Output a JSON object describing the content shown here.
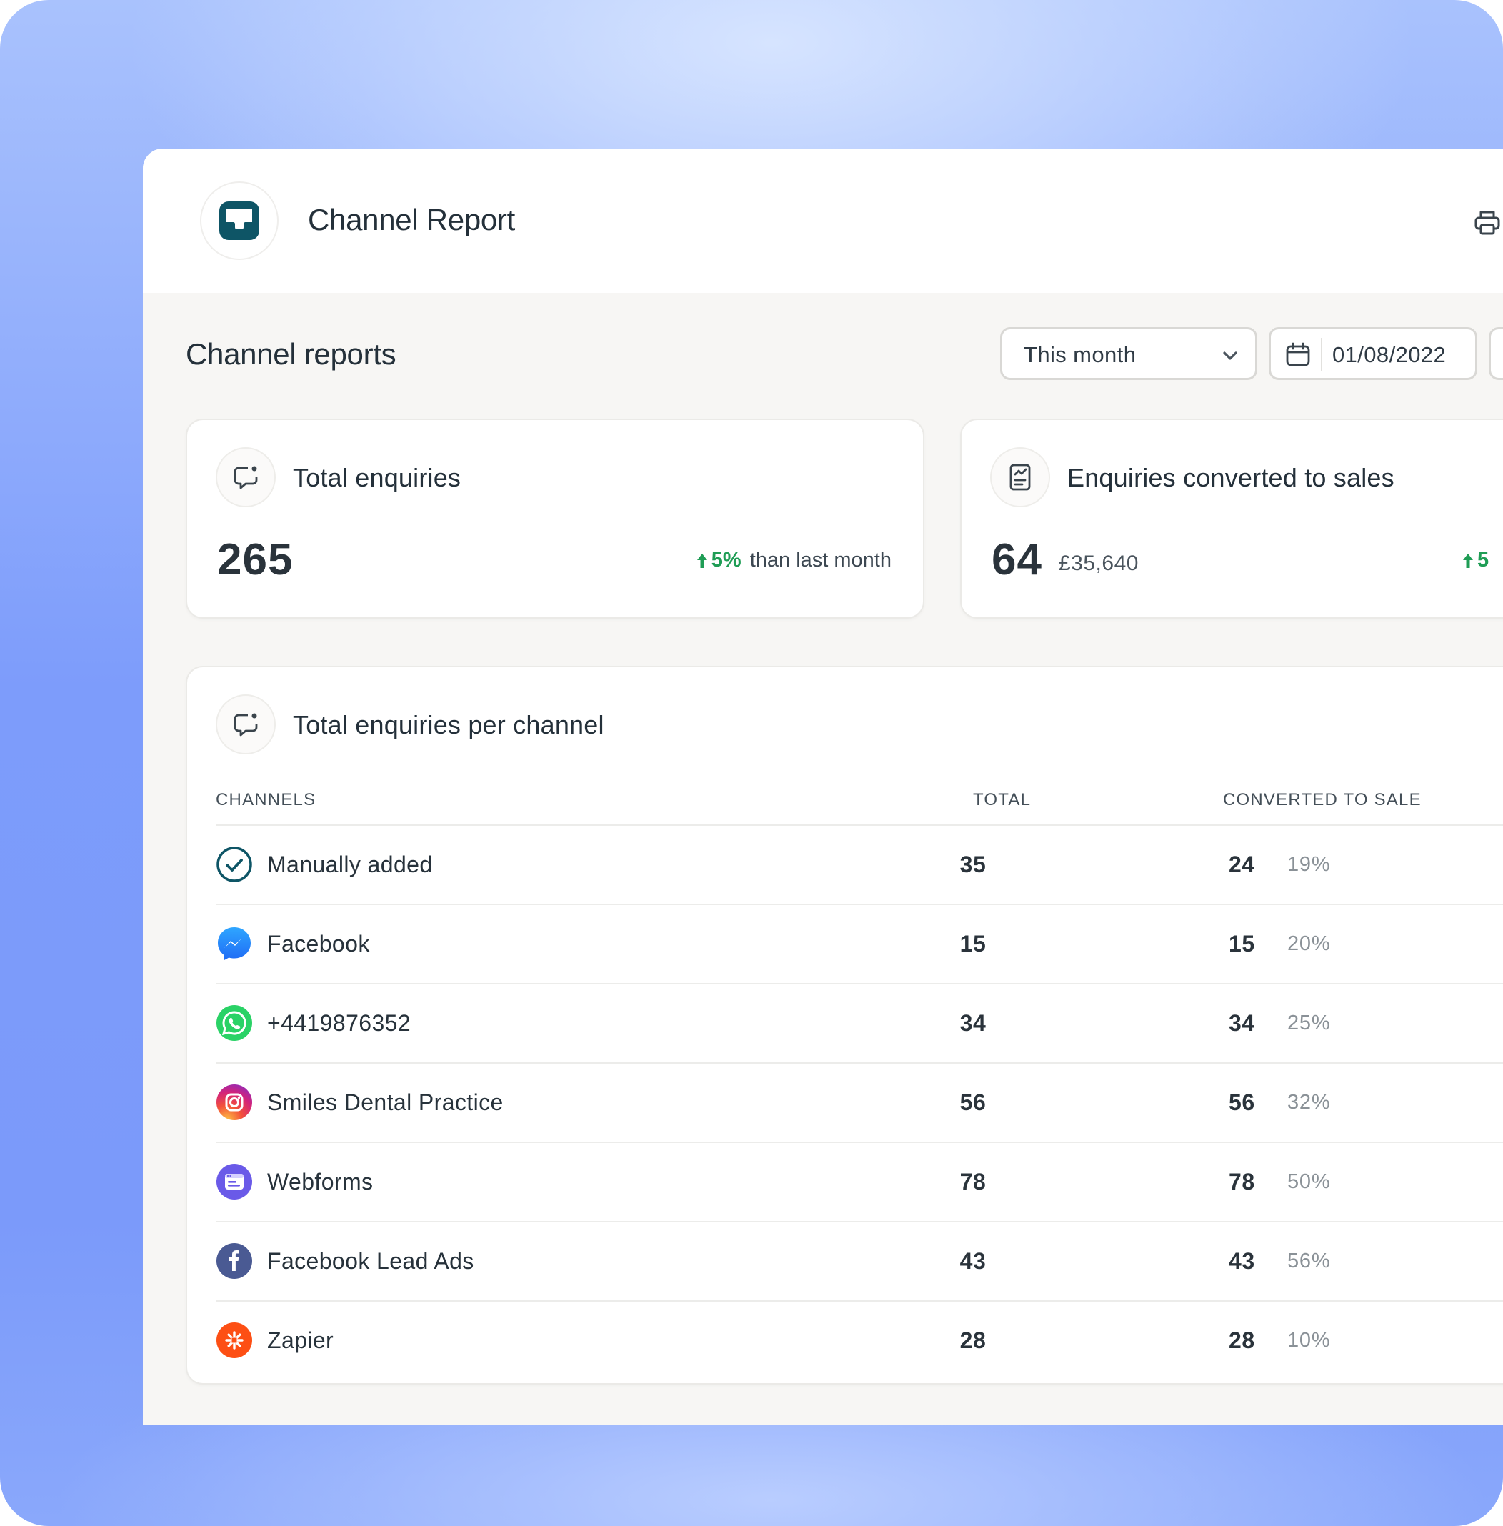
{
  "app": {
    "title": "Channel Report"
  },
  "page": {
    "title": "Channel reports"
  },
  "filters": {
    "period": "This month",
    "start_date": "01/08/2022"
  },
  "stats": {
    "total_enquiries": {
      "label": "Total enquiries",
      "value": "265",
      "change": "5%",
      "change_suffix": "than last month",
      "change_direction": "up"
    },
    "converted": {
      "label": "Enquiries converted to sales",
      "value": "64",
      "amount": "£35,640",
      "change": "5",
      "change_direction": "up"
    }
  },
  "table": {
    "title": "Total enquiries per channel",
    "columns": {
      "channel": "CHANNELS",
      "total": "TOTAL",
      "converted": "CONVERTED TO SALE"
    },
    "rows": [
      {
        "name": "Manually added",
        "icon": "checkmark-icon",
        "total": "35",
        "converted": "24",
        "pct": "19%"
      },
      {
        "name": "Facebook",
        "icon": "messenger-icon",
        "total": "15",
        "converted": "15",
        "pct": "20%"
      },
      {
        "name": "+4419876352",
        "icon": "whatsapp-icon",
        "total": "34",
        "converted": "34",
        "pct": "25%"
      },
      {
        "name": "Smiles Dental Practice",
        "icon": "instagram-icon",
        "total": "56",
        "converted": "56",
        "pct": "32%"
      },
      {
        "name": "Webforms",
        "icon": "webform-icon",
        "total": "78",
        "converted": "78",
        "pct": "50%"
      },
      {
        "name": "Facebook Lead Ads",
        "icon": "facebook-lead-ads-icon",
        "total": "43",
        "converted": "43",
        "pct": "56%"
      },
      {
        "name": "Zapier",
        "icon": "zapier-icon",
        "total": "28",
        "converted": "28",
        "pct": "10%"
      }
    ]
  },
  "colors": {
    "accent_dark_teal": "#0e5566",
    "positive_green": "#1f9d55",
    "background_blue": "#7d9cfb"
  }
}
